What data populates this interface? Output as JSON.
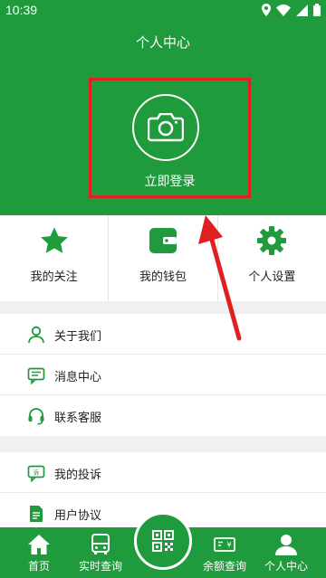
{
  "status": {
    "time": "10:39"
  },
  "header": {
    "title": "个人中心",
    "login_label": "立即登录"
  },
  "quick_actions": [
    {
      "label": "我的关注",
      "icon": "star-icon"
    },
    {
      "label": "我的钱包",
      "icon": "wallet-icon"
    },
    {
      "label": "个人设置",
      "icon": "gear-icon"
    }
  ],
  "menu_section_1": [
    {
      "label": "关于我们",
      "icon": "person-icon"
    },
    {
      "label": "消息中心",
      "icon": "message-icon"
    },
    {
      "label": "联系客服",
      "icon": "headset-icon"
    }
  ],
  "menu_section_2": [
    {
      "label": "我的投诉",
      "icon": "complaint-icon"
    },
    {
      "label": "用户协议",
      "icon": "document-icon"
    }
  ],
  "tabbar": [
    {
      "label": "首页",
      "icon": "home-icon"
    },
    {
      "label": "实时查询",
      "icon": "bus-icon"
    },
    {
      "label": "余额查询",
      "icon": "balance-icon"
    },
    {
      "label": "个人中心",
      "icon": "user-icon"
    }
  ],
  "colors": {
    "brand_green": "#1f9a3c",
    "highlight_red": "#e02020"
  }
}
